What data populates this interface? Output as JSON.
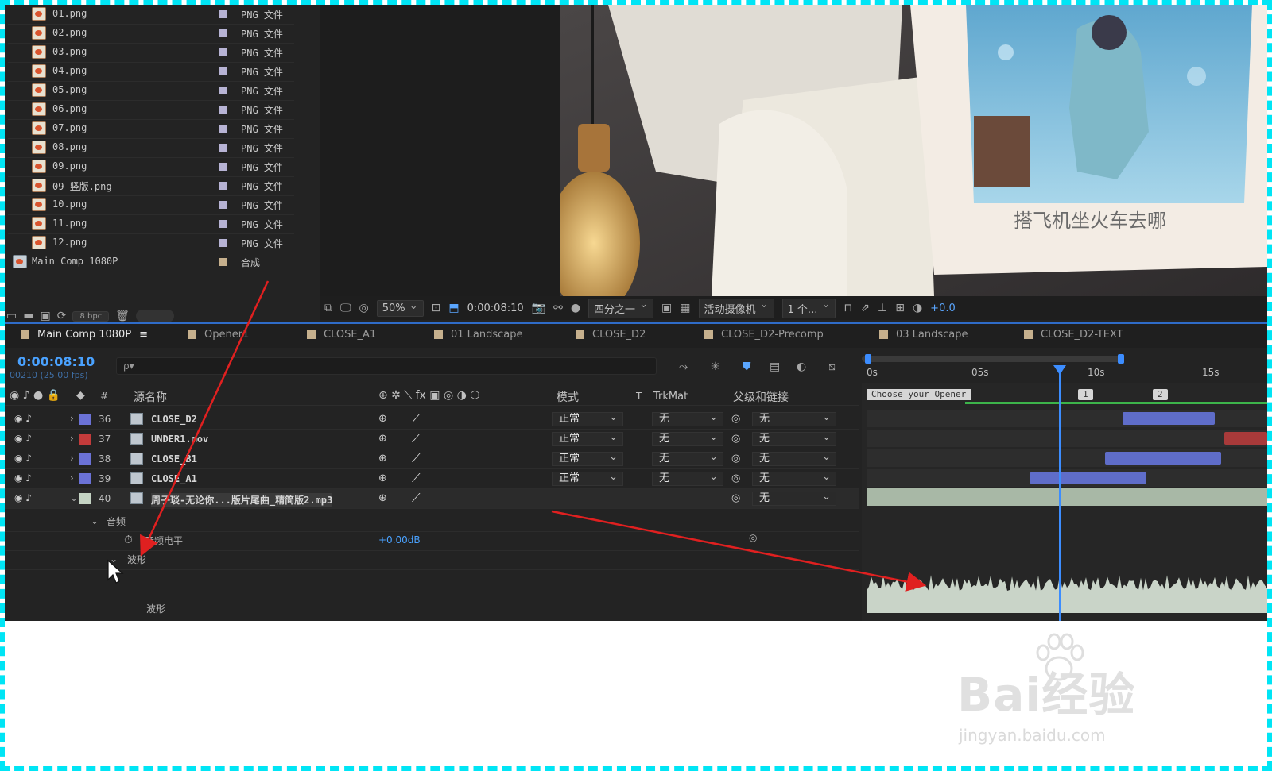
{
  "project": {
    "items": [
      {
        "name": "01.png",
        "type": "PNG 文件"
      },
      {
        "name": "02.png",
        "type": "PNG 文件"
      },
      {
        "name": "03.png",
        "type": "PNG 文件"
      },
      {
        "name": "04.png",
        "type": "PNG 文件"
      },
      {
        "name": "05.png",
        "type": "PNG 文件"
      },
      {
        "name": "06.png",
        "type": "PNG 文件"
      },
      {
        "name": "07.png",
        "type": "PNG 文件"
      },
      {
        "name": "08.png",
        "type": "PNG 文件"
      },
      {
        "name": "09.png",
        "type": "PNG 文件"
      },
      {
        "name": "09-竖版.png",
        "type": "PNG 文件"
      },
      {
        "name": "10.png",
        "type": "PNG 文件"
      },
      {
        "name": "11.png",
        "type": "PNG 文件"
      },
      {
        "name": "12.png",
        "type": "PNG 文件"
      }
    ],
    "comp": {
      "name": "Main Comp 1080P",
      "type": "合成"
    },
    "bpc": "8 bpc"
  },
  "viewer": {
    "caption": "搭飞机坐火车去哪",
    "zoom": "50%",
    "timecode": "0:00:08:10",
    "resolution": "四分之一",
    "camera": "活动摄像机",
    "views": "1 个...",
    "exposure": "+0.0"
  },
  "tabs": [
    {
      "label": "Main Comp 1080P",
      "active": true
    },
    {
      "label": "Opener1"
    },
    {
      "label": "CLOSE_A1"
    },
    {
      "label": "01 Landscape"
    },
    {
      "label": "CLOSE_D2"
    },
    {
      "label": "CLOSE_D2-Precomp"
    },
    {
      "label": "03 Landscape"
    },
    {
      "label": "CLOSE_D2-TEXT"
    }
  ],
  "timeline": {
    "timecode": "0:00:08:10",
    "fps": "00210 (25.00 fps)",
    "search_placeholder": "ρ▾",
    "headers": {
      "num": "#",
      "source": "源名称",
      "mode": "模式",
      "t": "T",
      "trkmat": "TrkMat",
      "parent": "父级和链接"
    },
    "layers": [
      {
        "num": "36",
        "name": "CLOSE_D2",
        "mode": "正常",
        "trk": "无",
        "parent": "无",
        "color": "#6b72d6"
      },
      {
        "num": "37",
        "name": "UNDER1.mov",
        "mode": "正常",
        "trk": "无",
        "parent": "无",
        "color": "#c33b3b"
      },
      {
        "num": "38",
        "name": "CLOSE_B1",
        "mode": "正常",
        "trk": "无",
        "parent": "无",
        "color": "#6b72d6"
      },
      {
        "num": "39",
        "name": "CLOSE_A1",
        "mode": "正常",
        "trk": "无",
        "parent": "无",
        "color": "#6b72d6"
      },
      {
        "num": "40",
        "name": "周子琰-无论你...版片尾曲_精简版2.mp3",
        "parent": "无",
        "color": "#c5d4c4"
      }
    ],
    "audio_group": "音频",
    "audio_levels_label": "音频电平",
    "audio_levels_value": "+0.00dB",
    "waveform_group": "波形",
    "waveform_label": "波形",
    "ruler": [
      "0s",
      "05s",
      "10s",
      "15s"
    ],
    "markers": [
      "Choose your Opener",
      "1",
      "2"
    ]
  },
  "watermark": {
    "brand": "Bai经验",
    "url": "jingyan.baidu.com"
  },
  "colors": {
    "accent": "#3c8dff",
    "timecode": "#4aa2ff",
    "frame": "#00e5f5",
    "arrow": "#e02020"
  }
}
